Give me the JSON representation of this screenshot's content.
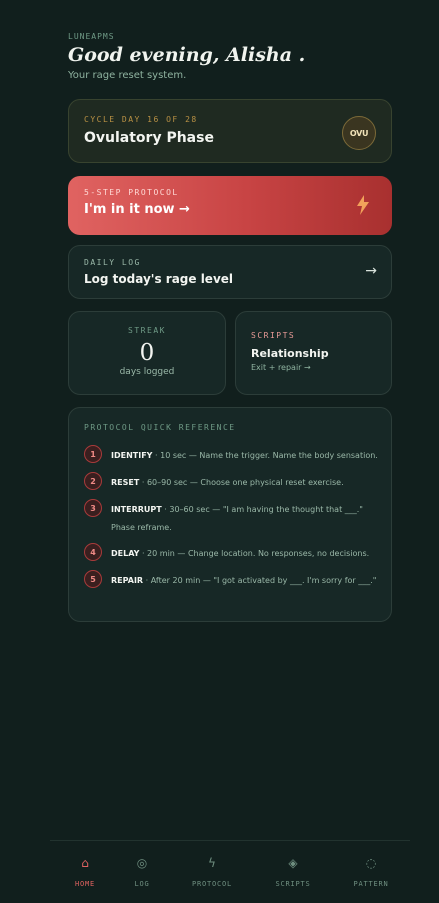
{
  "header": {
    "app_name": "LUNEAPMS",
    "greeting": "Good evening, Alisha .",
    "tagline": "Your rage reset system."
  },
  "cycle": {
    "label": "CYCLE DAY 16 OF 28",
    "phase": "Ovulatory Phase",
    "badge": "OVU"
  },
  "protocol": {
    "label": "5-STEP PROTOCOL",
    "title": "I'm in it now →",
    "icon": "bolt-icon"
  },
  "daily_log": {
    "label": "DAILY LOG",
    "title": "Log today's rage level",
    "arrow": "→"
  },
  "streak": {
    "label": "STREAK",
    "value": "0",
    "sub": "days logged"
  },
  "scripts": {
    "label": "SCRIPTS",
    "title": "Relationship",
    "sub": "Exit + repair →"
  },
  "quick_ref": {
    "label": "PROTOCOL QUICK REFERENCE",
    "steps": [
      {
        "num": "1",
        "name": "IDENTIFY",
        "text": " · 10 sec — Name the trigger. Name the body sensation."
      },
      {
        "num": "2",
        "name": "RESET",
        "text": " · 60–90 sec — Choose one physical reset exercise."
      },
      {
        "num": "3",
        "name": "INTERRUPT",
        "text": " · 30–60 sec — \"I am having the thought that ___.\" Phase reframe."
      },
      {
        "num": "4",
        "name": "DELAY",
        "text": " · 20 min — Change location. No responses, no decisions."
      },
      {
        "num": "5",
        "name": "REPAIR",
        "text": " · After 20 min — \"I got activated by ___. I'm sorry for ___.\""
      }
    ]
  },
  "nav": [
    {
      "label": "HOME",
      "icon": "⌂",
      "active": true
    },
    {
      "label": "LOG",
      "icon": "◎",
      "active": false
    },
    {
      "label": "PROTOCOL",
      "icon": "ϟ",
      "active": false
    },
    {
      "label": "SCRIPTS",
      "icon": "◈",
      "active": false
    },
    {
      "label": "PATTERN",
      "icon": "◌",
      "active": false
    }
  ],
  "colors": {
    "background": "#111f1d",
    "accent": "#e06361",
    "gold": "#b99144"
  }
}
